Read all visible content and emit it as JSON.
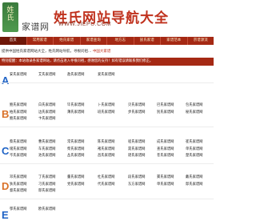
{
  "header": {
    "logo_glyph": "姓氏",
    "logo_subtitle": "家谱网",
    "title": "姓氏网站导航大全",
    "url": "WWW.JIEPU.COM"
  },
  "nav": {
    "items": [
      "首页",
      "常用家谱",
      "姓氏家谱",
      "家谱查询",
      "地方志",
      "族氏家谱",
      "家谱范本",
      "宗谱源流"
    ],
    "active_index": 0
  },
  "intro": {
    "text": "提供中国姓氏家谱网站大全，姓氏网站导航，寻根问祖…",
    "link": "中国大家谱"
  },
  "notice": "特别提醒：本站收录各家谱网站，请点击进入寻根问祖，感谢您的支持！如有错误请联系我们修正。",
  "sections": [
    {
      "letter": "A",
      "color": "#1f63c6",
      "rows": [
        [
          "安氏家谱网",
          "艾氏家谱网",
          "敖氏家谱网",
          "爱氏家谱网"
        ]
      ]
    },
    {
      "letter": "B",
      "color": "#d9722a",
      "rows": [
        [
          "鲍氏家谱网",
          "白氏家谱网",
          "毕氏家谱网",
          "卜氏家谱网",
          "贝氏家谱网",
          "巴氏家谱网",
          "包氏家谱网"
        ],
        [
          "柏氏家谱网",
          "边氏家谱网",
          "薄氏家谱网",
          "班氏家谱网",
          "步氏家谱网",
          "别氏家谱网",
          "秘氏家谱网"
        ],
        [
          "鲍氏家谱网",
          "卞氏家谱网"
        ]
      ]
    },
    {
      "letter": "C",
      "color": "#1f63c6",
      "rows": [
        [
          "蔡氏家谱网",
          "曹氏家谱网",
          "常氏家谱网",
          "陈氏家谱网",
          "程氏家谱网",
          "成氏家谱网",
          "崔氏家谱网"
        ],
        [
          "储氏家谱网",
          "车氏家谱网",
          "柴氏家谱网",
          "褚氏家谱网",
          "晁氏家谱网",
          "查氏家谱网",
          "单氏家谱网"
        ],
        [
          "岑氏家谱网",
          "池氏家谱网",
          "丛氏家谱网",
          "昌氏家谱网",
          "谌氏家谱网",
          "苍氏家谱网",
          "楚氏家谱网"
        ]
      ]
    },
    {
      "letter": "D",
      "color": "#d9722a",
      "rows": [
        [
          "邓氏家谱网",
          "丁氏家谱网",
          "董氏家谱网",
          "杜氏家谱网",
          "段氏家谱网",
          "窦氏家谱网",
          "戴氏家谱网"
        ],
        [
          "狄氏家谱网",
          "刁氏家谱网",
          "党氏家谱网",
          "代氏家谱网",
          "东方家谱网",
          "单氏家谱网",
          "邸氏家谱网"
        ],
        [
          "督氏家谱网",
          "邸氏家谱网"
        ]
      ]
    },
    {
      "letter": "E",
      "color": "#1f63c6",
      "rows": [
        [
          "鄂氏家谱网",
          "欧氏家谱网"
        ]
      ]
    }
  ]
}
